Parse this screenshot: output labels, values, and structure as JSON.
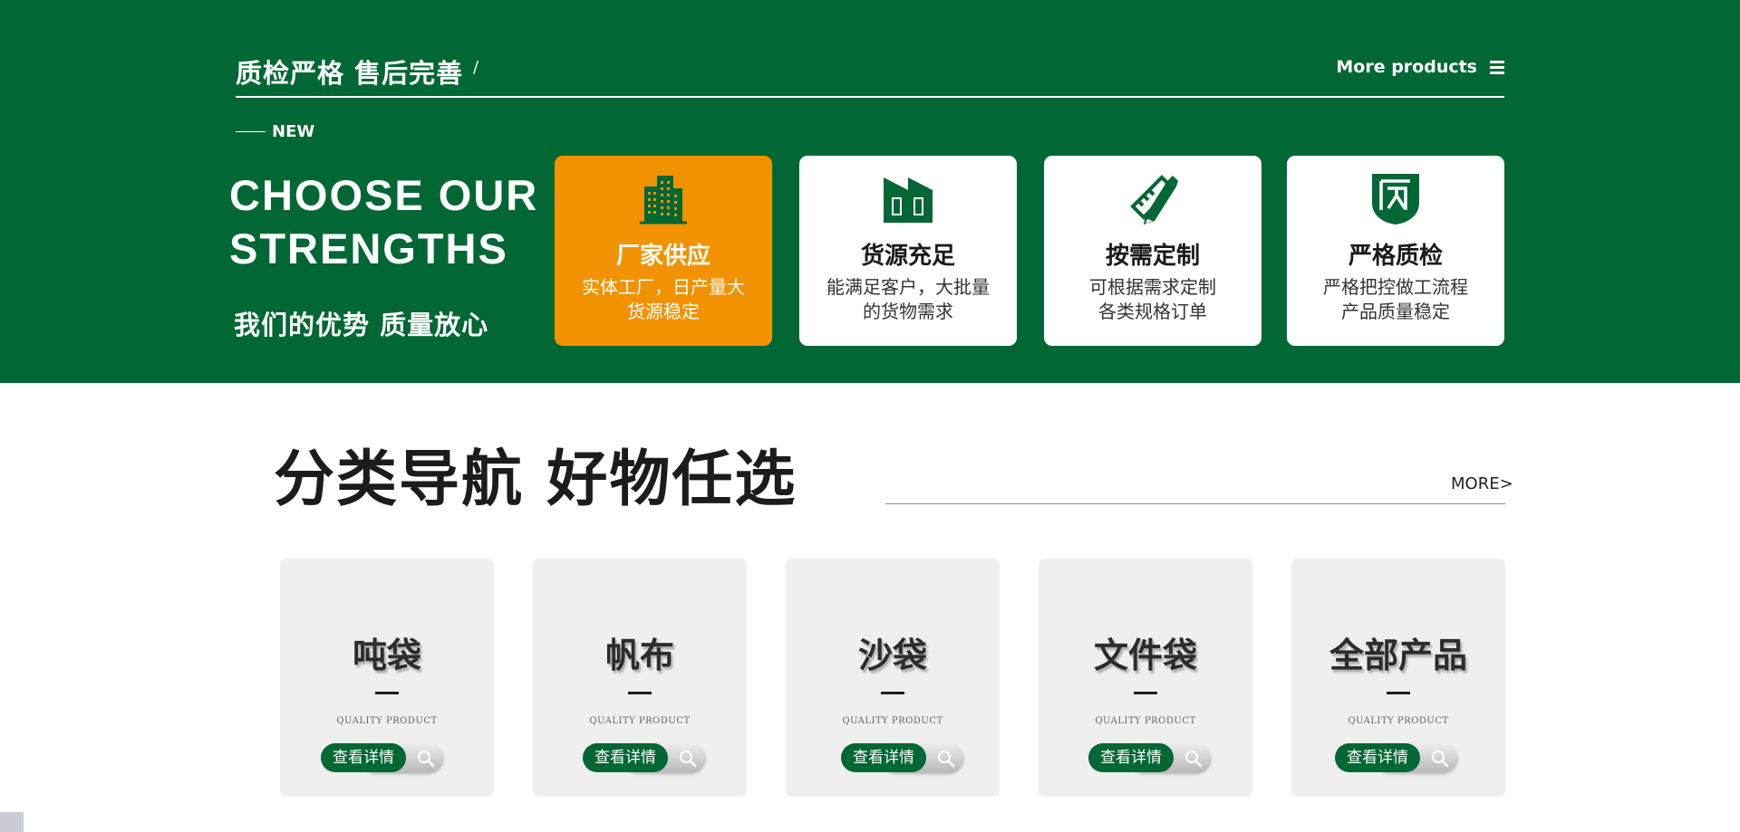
{
  "strengths": {
    "title": "质检严格 售后完善",
    "slash": "/",
    "more_label": "More products",
    "new_label": "NEW",
    "heading_line1": "CHOOSE OUR",
    "heading_line2": "STRENGTHS",
    "subheading": "我们的优势 质量放心",
    "cards": [
      {
        "title": "厂家供应",
        "line1": "实体工厂，日产量大",
        "line2": "货源稳定",
        "icon": "factory-building-icon"
      },
      {
        "title": "货源充足",
        "line1": "能满足客户，大批量",
        "line2": "的货物需求",
        "icon": "warehouse-icon"
      },
      {
        "title": "按需定制",
        "line1": "可根据需求定制",
        "line2": "各类规格订单",
        "icon": "pencil-ruler-icon"
      },
      {
        "title": "严格质检",
        "line1": "严格把控做工流程",
        "line2": "产品质量稳定",
        "icon": "quality-shield-icon"
      }
    ],
    "colors": {
      "band": "#016735",
      "active_card": "#f29200"
    }
  },
  "category": {
    "title": "分类导航 好物任选",
    "more_label": "MORE>",
    "items": [
      {
        "name": "吨袋",
        "tag": "QUALITY PRODUCT",
        "button": "查看详情"
      },
      {
        "name": "帆布",
        "tag": "QUALITY PRODUCT",
        "button": "查看详情"
      },
      {
        "name": "沙袋",
        "tag": "QUALITY PRODUCT",
        "button": "查看详情"
      },
      {
        "name": "文件袋",
        "tag": "QUALITY PRODUCT",
        "button": "查看详情"
      },
      {
        "name": "全部产品",
        "tag": "QUALITY PRODUCT",
        "button": "查看详情"
      }
    ]
  }
}
